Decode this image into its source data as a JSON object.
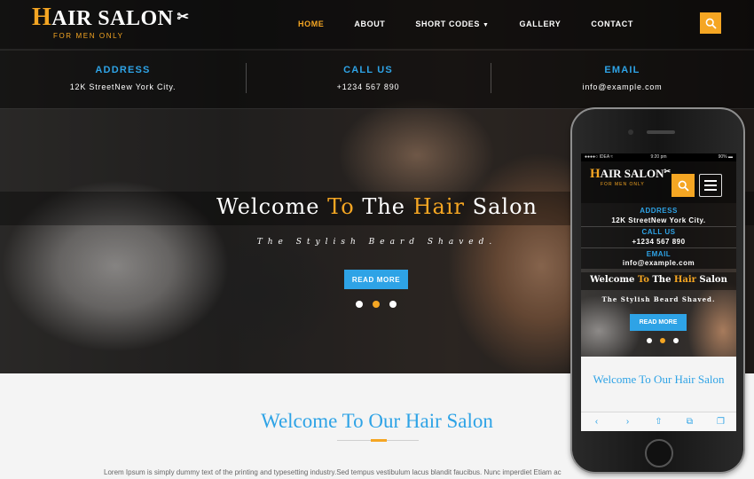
{
  "colors": {
    "accent": "#f5a623",
    "link_blue": "#2ea3e6",
    "dark_bg": "#1e1e1e",
    "light_bg": "#f4f4f4"
  },
  "logo": {
    "title_first": "H",
    "title_rest": "AIR SALON",
    "subtitle": "FOR MEN ONLY",
    "icon": "scissors-icon"
  },
  "nav": {
    "items": [
      {
        "label": "HOME",
        "active": true
      },
      {
        "label": "ABOUT"
      },
      {
        "label": "SHORT CODES",
        "dropdown": true
      },
      {
        "label": "GALLERY"
      },
      {
        "label": "CONTACT"
      }
    ],
    "search_icon": "search-icon"
  },
  "contact": {
    "address_label": "ADDRESS",
    "address_value": "12K StreetNew York City.",
    "call_label": "CALL US",
    "call_value": "+1234 567 890",
    "email_label": "EMAIL",
    "email_value": "info@example.com"
  },
  "banner": {
    "title_1": "Welcome ",
    "title_2": "To",
    "title_3": " The ",
    "title_4": "Hair",
    "title_5": " Salon",
    "subtitle": "The Stylish Beard Shaved.",
    "button_label": "READ MORE",
    "slides": 3,
    "active_slide": 2
  },
  "welcome": {
    "title": "Welcome To Our Hair Salon",
    "paragraph": "Lorem Ipsum is simply dummy text of the printing and typesetting industry.Sed tempus vestibulum lacus blandit faucibus. Nunc imperdiet Etiam ac"
  },
  "phone": {
    "status_left": "●●●●○ IDEA ≈",
    "status_time": "9:20 pm",
    "status_battery": "90% ▬",
    "logo_first": "H",
    "logo_rest": "AIR SALON",
    "logo_subtitle": "FOR MEN ONLY",
    "address_label": "ADDRESS",
    "address_value": "12K StreetNew York City.",
    "call_label": "CALL US",
    "call_value": "+1234 567 890",
    "email_label": "EMAIL",
    "email_value": "info@example.com",
    "banner_1": "Welcome ",
    "banner_2": "To",
    "banner_3": " The ",
    "banner_4": "Hair",
    "banner_5": " Salon",
    "banner_sub": "The Stylish Beard Shaved.",
    "read_more": "READ MORE",
    "welcome_title": "Welcome To Our Hair Salon",
    "toolbar": [
      "‹",
      "›",
      "⇧",
      "⧉",
      "❐"
    ]
  }
}
